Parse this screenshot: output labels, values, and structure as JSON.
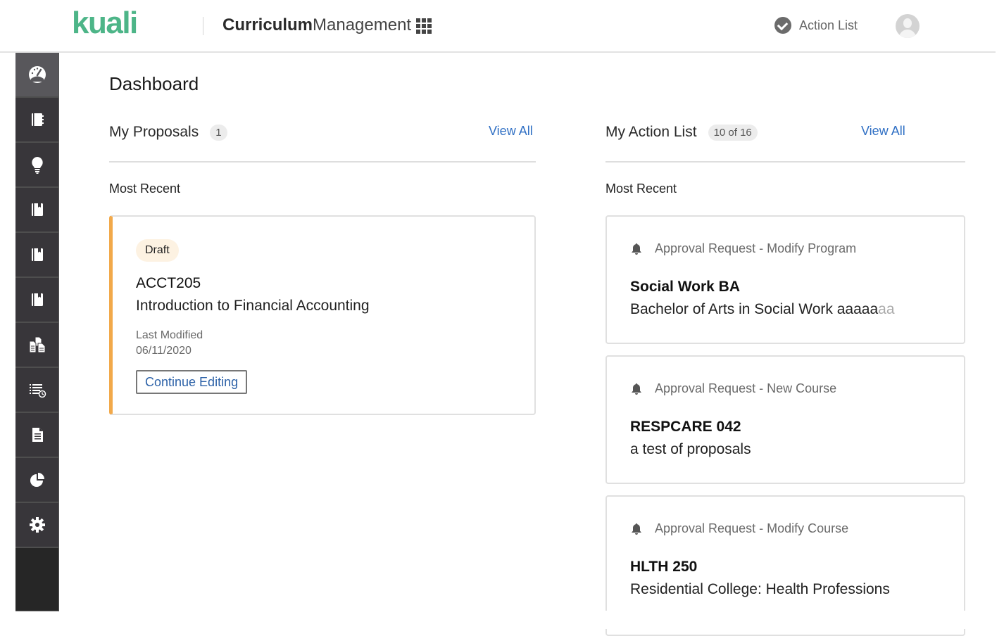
{
  "header": {
    "logo": "kuali",
    "app_name_bold": "Curriculum",
    "app_name_light": "Management",
    "apps_icon": "grid-apps-icon",
    "action_list_label": "Action List",
    "action_list_icon": "check-circle-icon",
    "avatar_icon": "user-avatar-icon"
  },
  "sidebar": {
    "items": [
      {
        "name": "dashboard",
        "icon": "speedometer-icon",
        "active": true
      },
      {
        "name": "programs",
        "icon": "notebook-icon"
      },
      {
        "name": "proposals",
        "icon": "lightbulb-icon"
      },
      {
        "name": "courses",
        "icon": "book-icon"
      },
      {
        "name": "specializations",
        "icon": "book-icon"
      },
      {
        "name": "experiences",
        "icon": "book-icon"
      },
      {
        "name": "documents",
        "icon": "copy-files-icon"
      },
      {
        "name": "action-list",
        "icon": "list-clock-icon"
      },
      {
        "name": "reports",
        "icon": "document-icon"
      },
      {
        "name": "analytics",
        "icon": "pie-chart-icon"
      },
      {
        "name": "settings",
        "icon": "gear-icon"
      }
    ]
  },
  "main": {
    "title": "Dashboard",
    "proposals": {
      "title": "My Proposals",
      "count": "1",
      "view_all": "View All",
      "subheading": "Most Recent",
      "items": [
        {
          "status": "Draft",
          "status_color": "#f2a94a",
          "code": "ACCT205",
          "title": "Introduction to Financial Accounting",
          "modified_label": "Last Modified",
          "modified_date": "06/11/2020",
          "action": "Continue Editing"
        }
      ]
    },
    "action_list": {
      "title": "My Action List",
      "count": "10 of 16",
      "view_all": "View All",
      "subheading": "Most Recent",
      "items": [
        {
          "type": "Approval Request - Modify Program",
          "code": "Social Work BA",
          "description": "Bachelor of Arts in Social Work aaaaa",
          "description_faded": "aa"
        },
        {
          "type": "Approval Request - New Course",
          "code": "RESPCARE 042",
          "description": "a test of proposals"
        },
        {
          "type": "Approval Request - Modify Course",
          "code": "HLTH 250",
          "description": "Residential College: Health Professions"
        }
      ]
    }
  },
  "colors": {
    "brand": "#4db588",
    "link": "#2f6fc4",
    "sidebar_bg": "#38363a",
    "sidebar_active": "#58575b",
    "draft_accent": "#f2a94a"
  }
}
